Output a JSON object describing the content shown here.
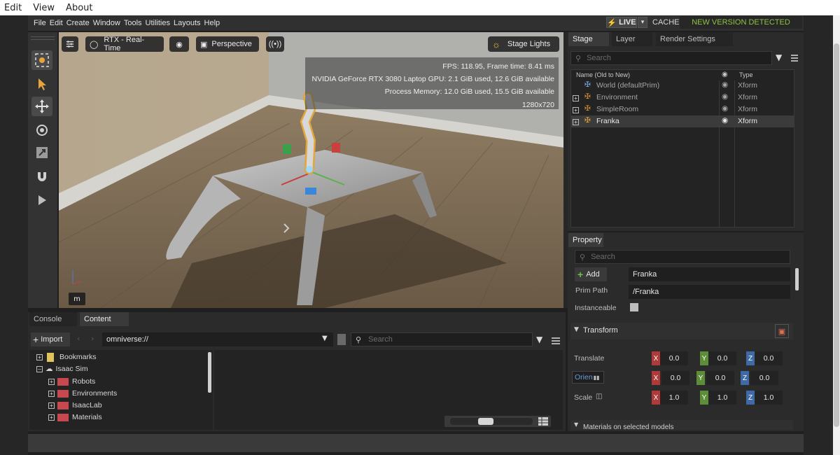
{
  "outer_menu": [
    "Edit",
    "View",
    "About"
  ],
  "menu": [
    "File",
    "Edit",
    "Create",
    "Window",
    "Tools",
    "Utilities",
    "Layouts",
    "Help"
  ],
  "live": {
    "label": "LIVE",
    "dropdown": "▾"
  },
  "cache": {
    "label": "CACHE:",
    "status": "NEW VERSION DETECTED"
  },
  "viewport": {
    "render_mode": "RTX - Real-Time",
    "camera": "Perspective",
    "lights": "Stage Lights",
    "stats": {
      "fps": "FPS: 118.95, Frame time: 8.41 ms",
      "gpu": "NVIDIA GeForce RTX 3080 Laptop GPU: 2.1 GiB used, 12.6 GiB available",
      "memory": "Process Memory: 12.0 GiB used, 15.5 GiB available",
      "resolution": "1280x720"
    },
    "units": "m"
  },
  "stage": {
    "tabs": [
      "Stage",
      "Layer",
      "Render Settings"
    ],
    "search_placeholder": "Search",
    "columns": {
      "name": "Name (Old to New)",
      "type": "Type"
    },
    "rows": [
      {
        "name": "World (defaultPrim)",
        "type": "Xform"
      },
      {
        "name": "Environment",
        "type": "Xform"
      },
      {
        "name": "SimpleRoom",
        "type": "Xform"
      },
      {
        "name": "Franka",
        "type": "Xform"
      }
    ]
  },
  "property": {
    "tab": "Property",
    "search_placeholder": "Search",
    "add_label": "Add",
    "name_value": "Franka",
    "prim_path_label": "Prim Path",
    "prim_path_value": "/Franka",
    "instanceable_label": "Instanceable",
    "transform_section": "Transform",
    "translate_label": "Translate",
    "orient_label": "Orien",
    "scale_label": "Scale",
    "translate": [
      "0.0",
      "0.0",
      "0.0"
    ],
    "orient": [
      "0.0",
      "0.0",
      "0.0"
    ],
    "scale": [
      "1.0",
      "1.0",
      "1.0"
    ],
    "axes": [
      "X",
      "Y",
      "Z"
    ],
    "materials_section": "Materials on selected models"
  },
  "bottom": {
    "tabs": [
      "Console",
      "Content"
    ],
    "import_label": "Import",
    "path": "omniverse://",
    "search_placeholder": "Search",
    "tree": [
      {
        "label": "Bookmarks",
        "level": 0
      },
      {
        "label": "Isaac Sim",
        "level": 0
      },
      {
        "label": "Robots",
        "level": 1
      },
      {
        "label": "Environments",
        "level": 1
      },
      {
        "label": "IsaacLab",
        "level": 1
      },
      {
        "label": "Materials",
        "level": 1
      }
    ]
  },
  "colors": {
    "accent_green": "#8fc240",
    "live_bolt": "#f6c20f",
    "axis_x": "#b03a3a",
    "axis_y": "#5e8d3a",
    "axis_z": "#3f6aa6"
  }
}
